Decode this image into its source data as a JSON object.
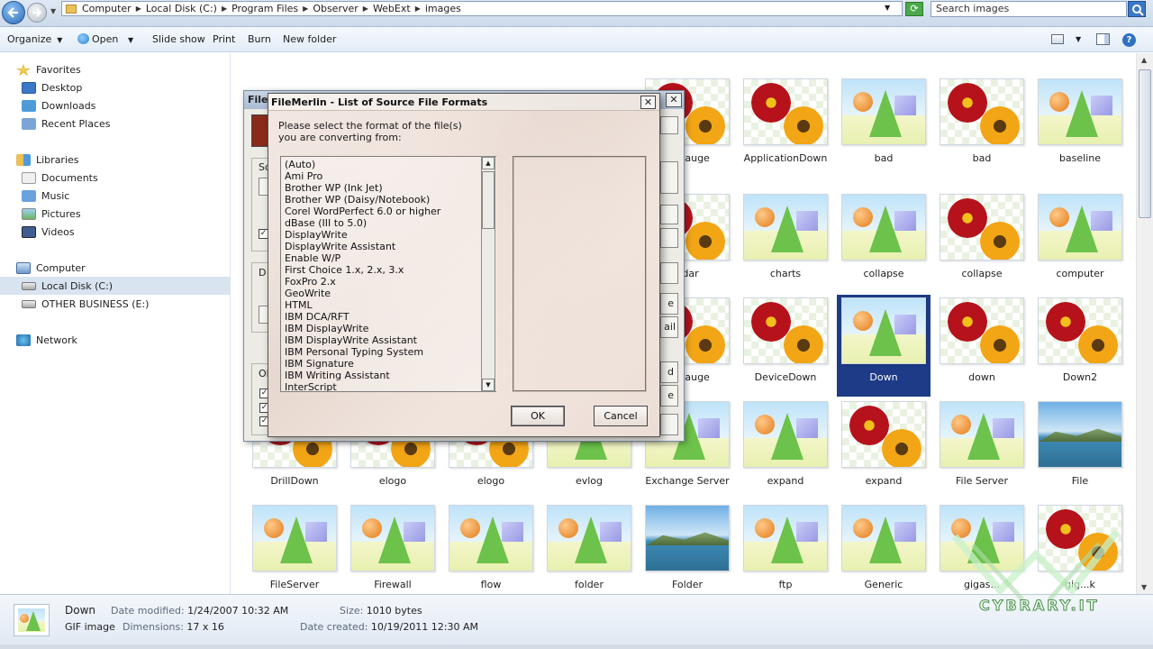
{
  "address": {
    "crumbs": [
      "Computer",
      "Local Disk (C:)",
      "Program Files",
      "Observer",
      "WebExt",
      "images"
    ],
    "search_placeholder": "Search images"
  },
  "toolbar": {
    "organize": "Organize",
    "open": "Open",
    "slideshow": "Slide show",
    "print": "Print",
    "burn": "Burn",
    "new_folder": "New folder"
  },
  "nav": {
    "favorites": "Favorites",
    "desktop": "Desktop",
    "downloads": "Downloads",
    "recent": "Recent Places",
    "libraries": "Libraries",
    "documents": "Documents",
    "music": "Music",
    "pictures": "Pictures",
    "videos": "Videos",
    "computer": "Computer",
    "local_disk": "Local Disk (C:)",
    "other_business": "OTHER BUSINESS (E:)",
    "network": "Network"
  },
  "files": [
    {
      "label": "onGauge",
      "art": "flower"
    },
    {
      "label": "ApplicationDown",
      "art": "flower"
    },
    {
      "label": "bad",
      "art": "cone"
    },
    {
      "label": "bad",
      "art": "flower"
    },
    {
      "label": "baseline",
      "art": "cone"
    },
    {
      "label": "ndar",
      "art": "flower"
    },
    {
      "label": "charts",
      "art": "cone"
    },
    {
      "label": "collapse",
      "art": "cone"
    },
    {
      "label": "collapse",
      "art": "flower"
    },
    {
      "label": "computer",
      "art": "cone"
    },
    {
      "label": "onGauge",
      "art": "flower"
    },
    {
      "label": "DeviceDown",
      "art": "flower"
    },
    {
      "label": "Down",
      "art": "cone"
    },
    {
      "label": "down",
      "art": "flower"
    },
    {
      "label": "Down2",
      "art": "flower"
    },
    {
      "label": "DrillDown",
      "art": "flower"
    },
    {
      "label": "elogo",
      "art": "flower"
    },
    {
      "label": "elogo",
      "art": "flower"
    },
    {
      "label": "evlog",
      "art": "cone"
    },
    {
      "label": "Exchange Server",
      "art": "cone"
    },
    {
      "label": "expand",
      "art": "cone"
    },
    {
      "label": "expand",
      "art": "flower"
    },
    {
      "label": "File Server",
      "art": "cone"
    },
    {
      "label": "File",
      "art": "lake"
    },
    {
      "label": "FileServer",
      "art": "cone"
    },
    {
      "label": "Firewall",
      "art": "cone"
    },
    {
      "label": "flow",
      "art": "cone"
    },
    {
      "label": "folder",
      "art": "cone"
    },
    {
      "label": "Folder",
      "art": "lake"
    },
    {
      "label": "ftp",
      "art": "cone"
    },
    {
      "label": "Generic",
      "art": "cone"
    },
    {
      "label": "gigas...",
      "art": "cone"
    },
    {
      "label": "gig...k",
      "art": "flower"
    }
  ],
  "selected_file": "Down",
  "details": {
    "name": "Down",
    "type": "GIF image",
    "modified_key": "Date modified:",
    "modified": "1/24/2007 10:32 AM",
    "dimensions_key": "Dimensions:",
    "dimensions": "17 x 16",
    "size_key": "Size:",
    "size": "1010 bytes",
    "created_key": "Date created:",
    "created": "10/19/2011 12:30 AM"
  },
  "back_dialog": {
    "title": "FileM",
    "labels": [
      "So",
      "D",
      "Ol"
    ],
    "side_buttons": [
      "e",
      "ail",
      "d",
      "e"
    ]
  },
  "dialog": {
    "title": "FileMerlin - List of Source File Formats",
    "close": "✕",
    "prompt_line1": "Please select the format of the file(s)",
    "prompt_line2": "you are converting from:",
    "formats": [
      "(Auto)",
      "Ami Pro",
      "Brother WP (Ink Jet)",
      "Brother WP (Daisy/Notebook)",
      "Corel WordPerfect 6.0 or higher",
      "dBase (III to 5.0)",
      "DisplayWrite",
      "DisplayWrite Assistant",
      "Enable W/P",
      "First Choice 1.x, 2.x, 3.x",
      "FoxPro 2.x",
      "GeoWrite",
      "HTML",
      "IBM DCA/RFT",
      "IBM DisplayWrite",
      "IBM DisplayWrite Assistant",
      "IBM Personal Typing System",
      "IBM Signature",
      "IBM Writing Assistant",
      "InterScript"
    ],
    "ok": "OK",
    "cancel": "Cancel"
  },
  "watermark": "CYBRARY.IT",
  "colors": {
    "selection": "#1d3b86",
    "dialog_bg": "#efe4dd",
    "toolbar": "#e3ecf7"
  }
}
